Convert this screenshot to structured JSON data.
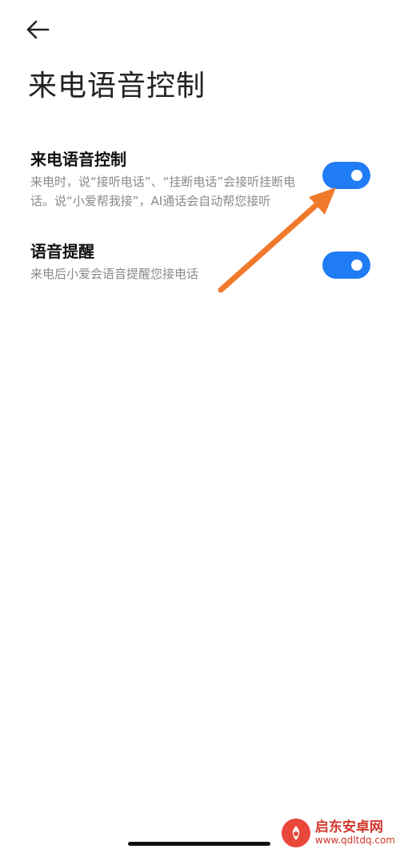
{
  "header": {
    "back_icon": "arrow-left-icon",
    "title": "来电语音控制"
  },
  "settings": [
    {
      "title": "来电语音控制",
      "description": "来电时，说“接听电话”、“挂断电话”会接听挂断电话。说“小爱帮我接”，AI通话会自动帮您接听",
      "enabled": true
    },
    {
      "title": "语音提醒",
      "description": "来电后小爱会语音提醒您接电话",
      "enabled": true
    }
  ],
  "annotation": {
    "arrow_color": "#f07a2c"
  },
  "colors": {
    "toggle_on": "#1f7cf5",
    "title_text": "#111111",
    "desc_text": "#8a8a8a"
  },
  "watermark": {
    "name": "启东安卓网",
    "url": "www.qdltdq.com"
  }
}
